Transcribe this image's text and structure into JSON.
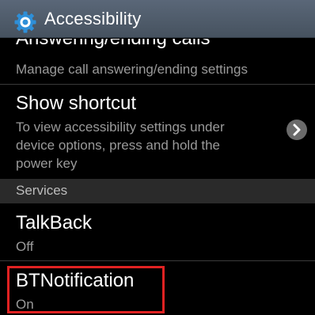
{
  "header": {
    "title": "Accessibility",
    "icon": "gear-icon"
  },
  "list": {
    "partial_item": {
      "title": "Answering/ending calls",
      "subtitle": "Manage call answering/ending settings"
    },
    "show_shortcut": {
      "title": "Show shortcut",
      "subtitle_lines": [
        "To view accessibility settings under",
        "device options, press and hold the",
        "power key"
      ]
    },
    "section": {
      "label": "Services"
    },
    "talkback": {
      "title": "TalkBack",
      "status": "Off"
    },
    "btnotification": {
      "title": "BTNotification",
      "status": "On"
    }
  },
  "colors": {
    "titlebar": "#4f5b69",
    "highlight": "#e02222",
    "gear": "#2e8fd8"
  }
}
